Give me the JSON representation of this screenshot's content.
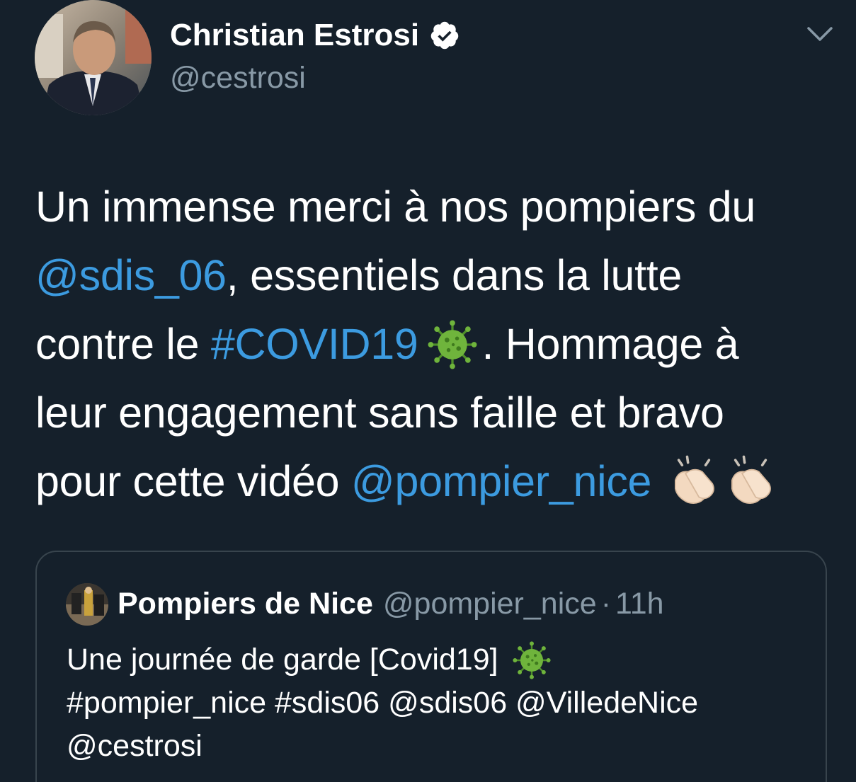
{
  "author": {
    "display_name": "Christian Estrosi",
    "handle": "@cestrosi",
    "verified_icon": "verified-badge-icon"
  },
  "menu": {
    "icon": "chevron-down-icon"
  },
  "tweet": {
    "line1": "Un immense merci à nos pompiers du",
    "mention_sdis": "@sdis_06",
    "line2_rest": ", essentiels dans la lutte",
    "line3_start": "contre le ",
    "hashtag_covid": "#COVID19",
    "line3_end": ". Hommage à",
    "line4": "leur engagement sans faille et bravo",
    "line5_start": "pour cette vidéo ",
    "mention_pompier": "@pompier_nice",
    "emoji_virus": "virus-emoji",
    "emoji_clap": "clapping-hands-emoji"
  },
  "quoted_tweet": {
    "display_name": "Pompiers de Nice",
    "handle": "@pompier_nice",
    "separator": "·",
    "time": "11h",
    "line1": "Une journée de garde [Covid19]",
    "line2": "#pompier_nice #sdis06 @sdis06 @VilledeNice",
    "line3": "@cestrosi"
  },
  "colors": {
    "background": "#15202b",
    "link": "#3c9be0",
    "secondary_text": "#8899a6",
    "border": "#38444d"
  }
}
